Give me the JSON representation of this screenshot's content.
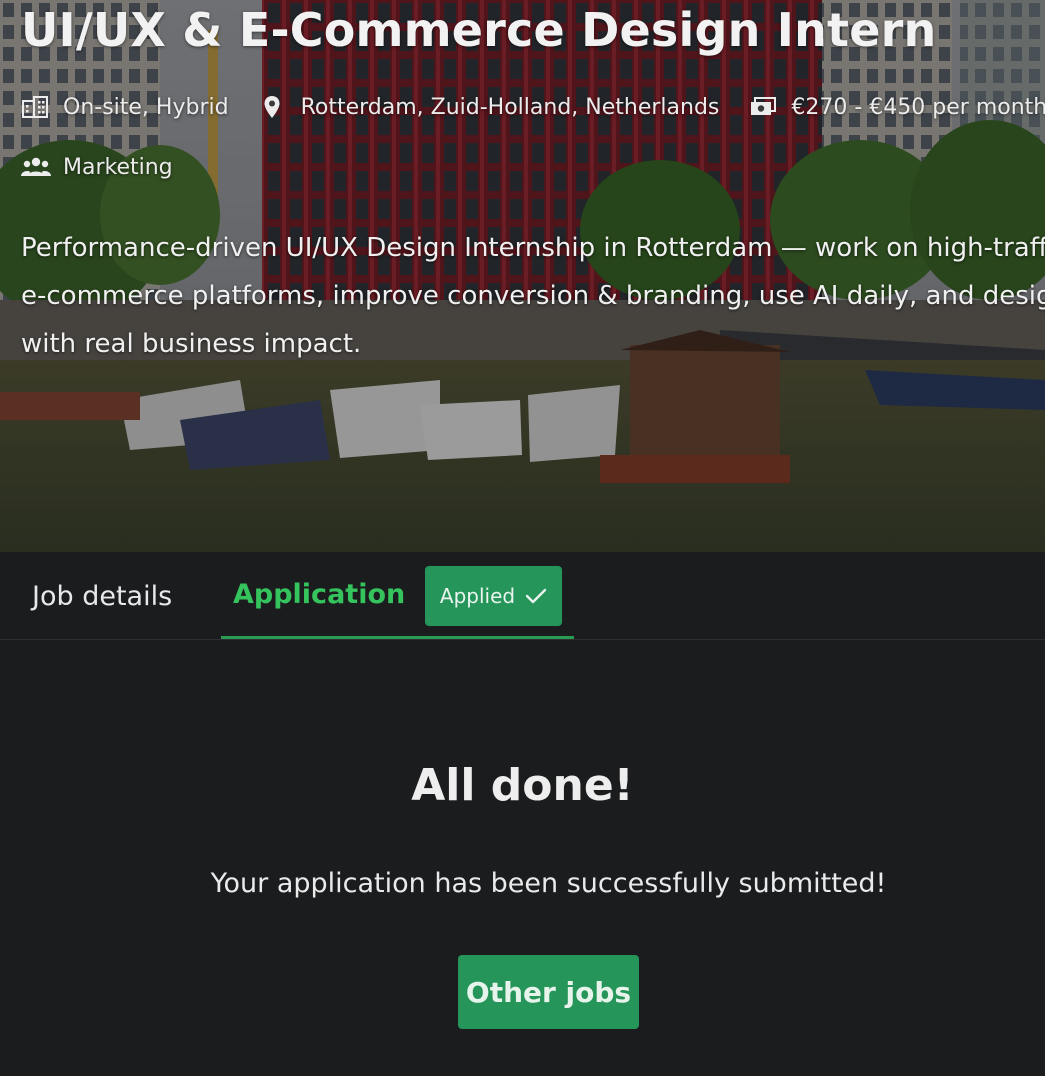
{
  "job": {
    "title": "UI/UX & E-Commerce Design Intern",
    "workplace": "On-site, Hybrid",
    "location": "Rotterdam, Zuid-Holland, Netherlands",
    "salary": "€270 - €450 per month",
    "department": "Marketing",
    "summary": "Performance-driven UI/UX Design Internship in Rotterdam — work on high-traffic e-commerce platforms, improve conversion & branding, use AI daily, and design with real business impact."
  },
  "icons": {
    "workplace": "office-building-icon",
    "location": "map-pin-icon",
    "salary": "money-bill-icon",
    "department": "people-icon",
    "applied": "checkmark-icon"
  },
  "tabs": {
    "job_details": "Job details",
    "application": "Application",
    "applied_badge": "Applied"
  },
  "confirmation": {
    "title": "All done!",
    "message": "Your application has been successfully submitted!",
    "other_jobs_button": "Other jobs"
  },
  "colors": {
    "accent_green": "#26955a",
    "active_tab_text": "#35c35d",
    "background": "#1b1c1e"
  }
}
